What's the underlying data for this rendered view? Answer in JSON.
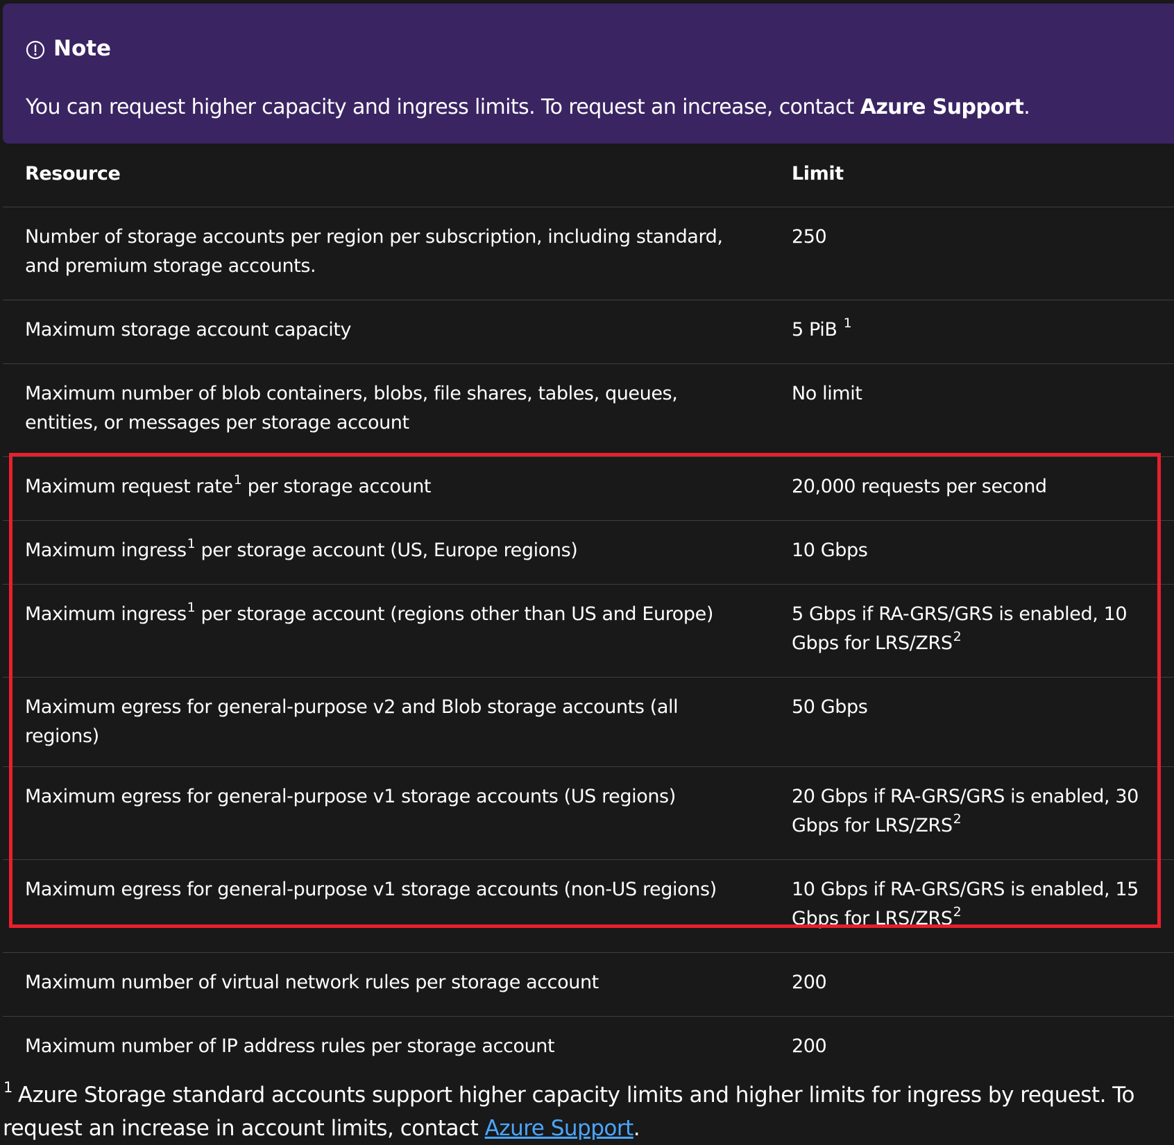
{
  "note": {
    "title": "Note",
    "icon": "info-circle-icon",
    "text_prefix": "You can request higher capacity and ingress limits. To request an increase, contact ",
    "text_bold": "Azure Support",
    "text_suffix": "."
  },
  "table": {
    "headers": [
      "Resource",
      "Limit"
    ],
    "rows": [
      {
        "resource": "Number of storage accounts per region per subscription, including standard, and premium storage accounts.",
        "limit": "250"
      },
      {
        "resource": "Maximum storage account capacity",
        "limit": "5 PiB",
        "limit_sup": "1"
      },
      {
        "resource": "Maximum number of blob containers, blobs, file shares, tables, queues, entities, or messages per storage account",
        "limit": "No limit"
      },
      {
        "resource_a": "Maximum request rate",
        "resource_sup": "1",
        "resource_b": " per storage account",
        "limit": "20,000 requests per second"
      },
      {
        "resource_a": "Maximum ingress",
        "resource_sup": "1",
        "resource_b": " per storage account (US, Europe regions)",
        "limit": "10 Gbps"
      },
      {
        "resource_a": "Maximum ingress",
        "resource_sup": "1",
        "resource_b": " per storage account (regions other than US and Europe)",
        "limit": "5 Gbps if RA-GRS/GRS is enabled, 10 Gbps for LRS/ZRS",
        "limit_sup": "2"
      },
      {
        "resource": "Maximum egress for general-purpose v2 and Blob storage accounts (all regions)",
        "limit": "50 Gbps"
      },
      {
        "resource": "Maximum egress for general-purpose v1 storage accounts (US regions)",
        "limit": "20 Gbps if RA-GRS/GRS is enabled, 30 Gbps for LRS/ZRS",
        "limit_sup": "2"
      },
      {
        "resource": "Maximum egress for general-purpose v1 storage accounts (non-US regions)",
        "limit": "10 Gbps if RA-GRS/GRS is enabled, 15 Gbps for LRS/ZRS",
        "limit_sup": "2"
      },
      {
        "resource": "Maximum number of virtual network rules per storage account",
        "limit": "200"
      },
      {
        "resource": "Maximum number of IP address rules per storage account",
        "limit": "200"
      }
    ]
  },
  "footnote": {
    "sup": "1",
    "text": "Azure Storage standard accounts support higher capacity limits and higher limits for ingress by request. To request an increase in account limits, contact ",
    "link": "Azure Support",
    "suffix": "."
  },
  "colors": {
    "background": "#191919",
    "note_background": "#3a2462",
    "highlight_border": "#e8202d",
    "link": "#4aa6ff"
  }
}
